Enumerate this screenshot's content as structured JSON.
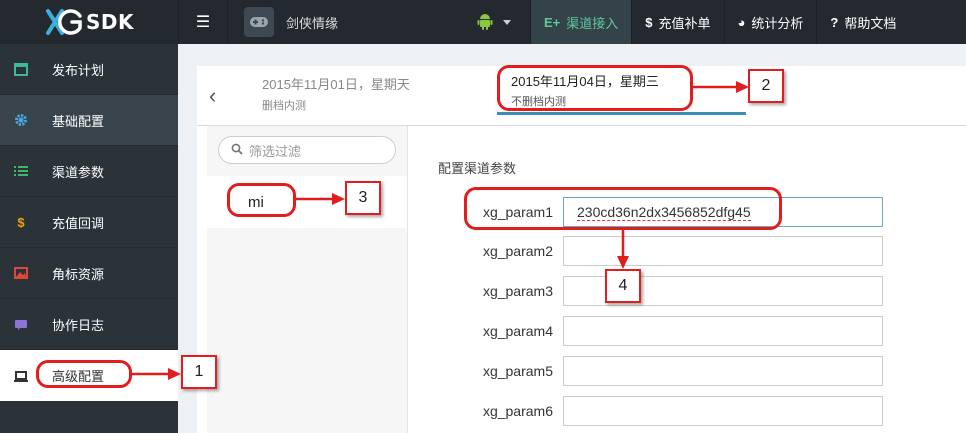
{
  "brand": {
    "logo_text": "SDK"
  },
  "topbar": {
    "game_name": "剑侠情缘",
    "nav": [
      {
        "icon": "E+",
        "label": "渠道接入",
        "active": true
      },
      {
        "icon": "$",
        "label": "充值补单",
        "active": false
      },
      {
        "icon": "◕",
        "label": "统计分析",
        "active": false
      },
      {
        "icon": "?",
        "label": "帮助文档",
        "active": false
      }
    ]
  },
  "sidebar": {
    "items": [
      {
        "label": "发布计划",
        "icon": "calendar-icon",
        "color": "#3bb8a0"
      },
      {
        "label": "基础配置",
        "icon": "gear-icon",
        "color": "#4aa3df"
      },
      {
        "label": "渠道参数",
        "icon": "list-icon",
        "color": "#3bb86a"
      },
      {
        "label": "充值回调",
        "icon": "dollar-icon",
        "color": "#f0a30a"
      },
      {
        "label": "角标资源",
        "icon": "image-icon",
        "color": "#e0483c"
      },
      {
        "label": "协作日志",
        "icon": "chat-icon",
        "color": "#8d73d6"
      },
      {
        "label": "高级配置",
        "icon": "laptop-icon",
        "color": "#333333"
      }
    ]
  },
  "dates": {
    "first": {
      "date": "2015年11月01日，星期天",
      "sub": "删档内测"
    },
    "second": {
      "date": "2015年11月04日，星期三",
      "sub": "不删档内测"
    }
  },
  "filter": {
    "placeholder": "筛选过滤"
  },
  "channel": {
    "name": "mi"
  },
  "form": {
    "title": "配置渠道参数",
    "params": [
      {
        "label": "xg_param1",
        "value": "230cd36n2dx3456852dfg45"
      },
      {
        "label": "xg_param2",
        "value": ""
      },
      {
        "label": "xg_param3",
        "value": ""
      },
      {
        "label": "xg_param4",
        "value": ""
      },
      {
        "label": "xg_param5",
        "value": ""
      },
      {
        "label": "xg_param6",
        "value": ""
      }
    ]
  },
  "annotations": {
    "n1": "1",
    "n2": "2",
    "n3": "3",
    "n4": "4"
  },
  "colors": {
    "accent": "#5ec89e",
    "annotation": "#e21d1d",
    "tab_underline": "#3a8fb7"
  }
}
